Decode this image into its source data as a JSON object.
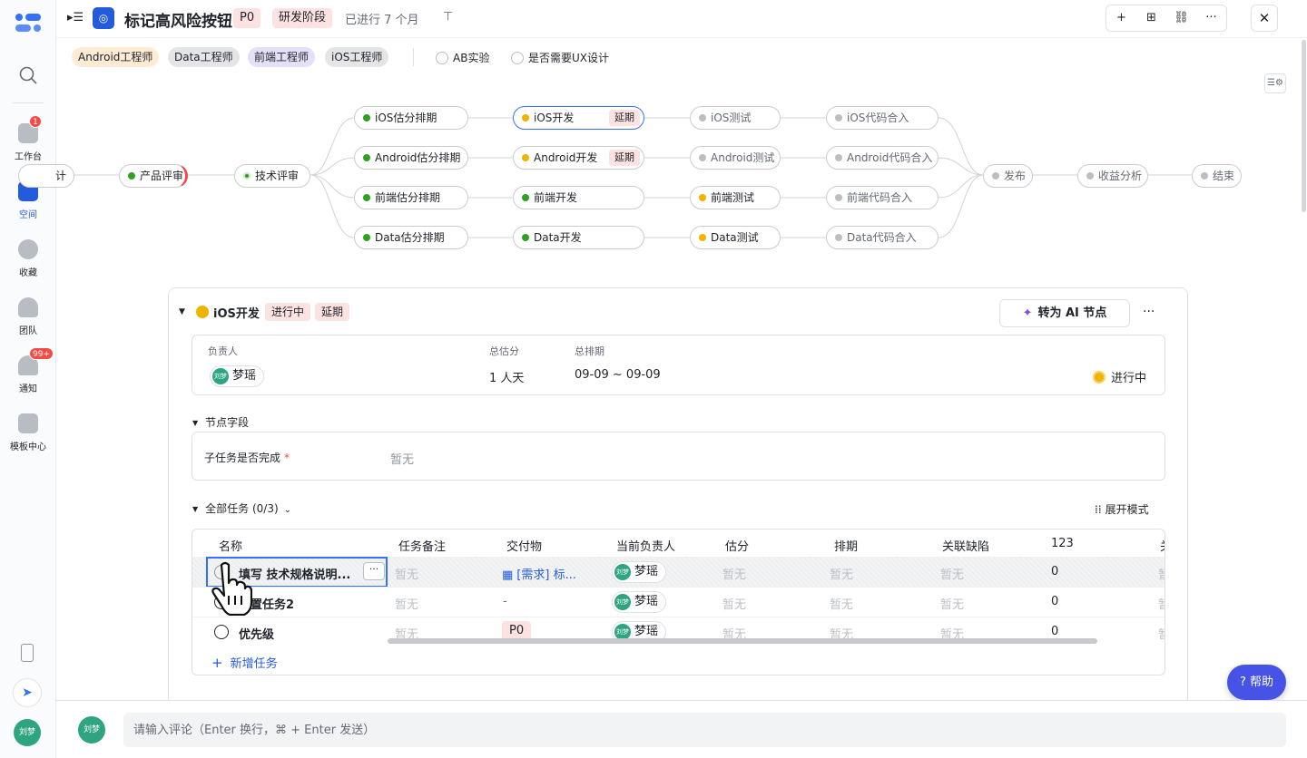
{
  "rail": {
    "items": [
      {
        "label": "工作台",
        "badge": "1"
      },
      {
        "label": "空间",
        "badge": ""
      },
      {
        "label": "收藏",
        "badge": ""
      },
      {
        "label": "团队",
        "badge": ""
      },
      {
        "label": "通知",
        "badge": "99+"
      },
      {
        "label": "模板中心",
        "badge": ""
      }
    ],
    "avatar": "刘梦",
    "icons": {
      "search": "search-icon",
      "phone": "phone-icon",
      "rocket": "rocket-icon"
    }
  },
  "header": {
    "title": "标记高风险按钮",
    "priority": "P0",
    "stage": "研发阶段",
    "elapsed": "已进行 7 个月",
    "actions": [
      "+",
      "⊞",
      "⛓",
      "···"
    ],
    "close": "✕"
  },
  "teams": {
    "chips": [
      "Android工程师",
      "Data工程师",
      "前端工程师",
      "iOS工程师"
    ],
    "chip_colors": [
      "#fdebd3",
      "#e4e5e7",
      "#e3e0f7",
      "#e4e5e7"
    ],
    "options": [
      "AB实验",
      "是否需要UX设计"
    ]
  },
  "flow": {
    "nodes": {
      "design": "计",
      "product_review": "产品评审",
      "tech_review": "技术评审",
      "ios_est": "iOS估分排期",
      "android_est": "Android估分排期",
      "fe_est": "前端估分排期",
      "data_est": "Data估分排期",
      "ios_dev": "iOS开发",
      "android_dev": "Android开发",
      "fe_dev": "前端开发",
      "data_dev": "Data开发",
      "ios_test": "iOS测试",
      "android_test": "Android测试",
      "fe_test": "前端测试",
      "data_test": "Data测试",
      "ios_merge": "iOS代码合入",
      "android_merge": "Android代码合入",
      "fe_merge": "前端代码合入",
      "data_merge": "Data代码合入",
      "release": "发布",
      "revenue": "收益分析",
      "end": "结束"
    },
    "delay_tag": "延期",
    "colors": {
      "done": "#2ea121",
      "doing": "#f0b400",
      "todo": "#bbbfc4",
      "selected": "#3370ff"
    }
  },
  "node_card": {
    "title": "iOS开发",
    "status": "进行中",
    "delay": "延期",
    "ai_button": "转为 AI 节点",
    "more": "···",
    "info": {
      "owner_label": "负责人",
      "owner_name": "梦瑶",
      "owner_avatar": "刘梦",
      "estimate_label": "总估分",
      "estimate": "1 人天",
      "schedule_label": "总排期",
      "schedule": "09-09 ~ 09-09",
      "status": "进行中"
    },
    "fields_section": "节点字段",
    "field": {
      "label": "子任务是否完成",
      "required": "*",
      "value": "暂无"
    },
    "tasks_section": "全部任务 (0/3)",
    "expand_mode": "展开模式",
    "columns": [
      "名称",
      "任务备注",
      "交付物",
      "当前负责人",
      "估分",
      "排期",
      "关联缺陷",
      "123",
      "关"
    ],
    "rows": [
      {
        "name": "填写 技术规格说明...",
        "note": "暂无",
        "deliverable": "[需求] 标...",
        "owner": "梦瑶",
        "avatar": "刘梦",
        "estimate": "暂无",
        "schedule": "暂无",
        "defects": "暂无",
        "n123": "0",
        "tail": "暂"
      },
      {
        "name": "置任务2",
        "note": "暂无",
        "deliverable": "-",
        "owner": "梦瑶",
        "avatar": "刘梦",
        "estimate": "暂无",
        "schedule": "暂无",
        "defects": "暂无",
        "n123": "0",
        "tail": "暂"
      },
      {
        "name": "优先级",
        "note": "暂无",
        "deliverable": "P0",
        "owner": "梦瑶",
        "avatar": "刘梦",
        "estimate": "暂无",
        "schedule": "暂无",
        "defects": "暂无",
        "n123": "0",
        "tail": "暂"
      }
    ],
    "add_task": "新增任务"
  },
  "help": "帮助",
  "comment": {
    "avatar": "刘梦",
    "placeholder": "请输入评论（Enter 换行，⌘ + Enter 发送）"
  }
}
